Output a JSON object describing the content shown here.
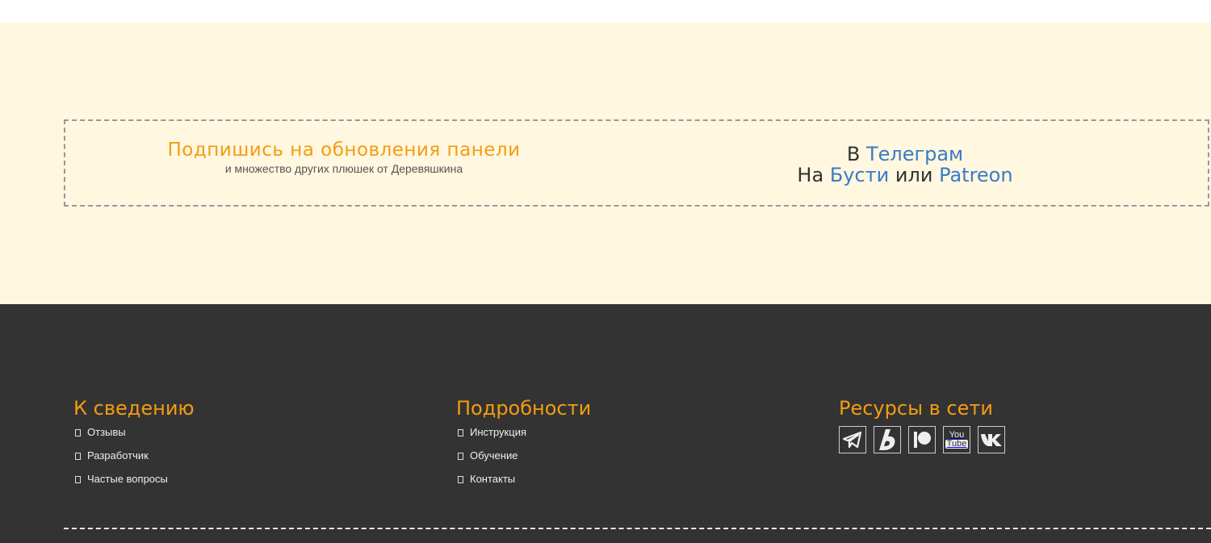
{
  "subscribe": {
    "title": "Подпишись на обновления панели",
    "subtitle": "и множество других плюшек от Деревяшкина",
    "line1_prefix": "В ",
    "telegram": "Телеграм",
    "line2_prefix": "На ",
    "boosty": "Бусти",
    "or": " или ",
    "patreon": "Patreon"
  },
  "footer": {
    "col1": {
      "heading": "К сведению",
      "items": [
        "Отзывы",
        "Разработчик",
        "Частые вопросы"
      ]
    },
    "col2": {
      "heading": "Подробности",
      "items": [
        "Инструкция",
        "Обучение",
        "Контакты"
      ]
    },
    "col3": {
      "heading": "Ресурсы в сети",
      "icons": [
        "telegram-icon",
        "boosty-icon",
        "patreon-icon",
        "youtube-icon",
        "vk-icon"
      ],
      "youtube_text_top": "You",
      "youtube_text_bottom": "Tube"
    }
  },
  "colors": {
    "accent": "#f39c12",
    "link": "#3a7bc8",
    "subscribe_bg": "#fff7df",
    "footer_bg": "#333333"
  }
}
